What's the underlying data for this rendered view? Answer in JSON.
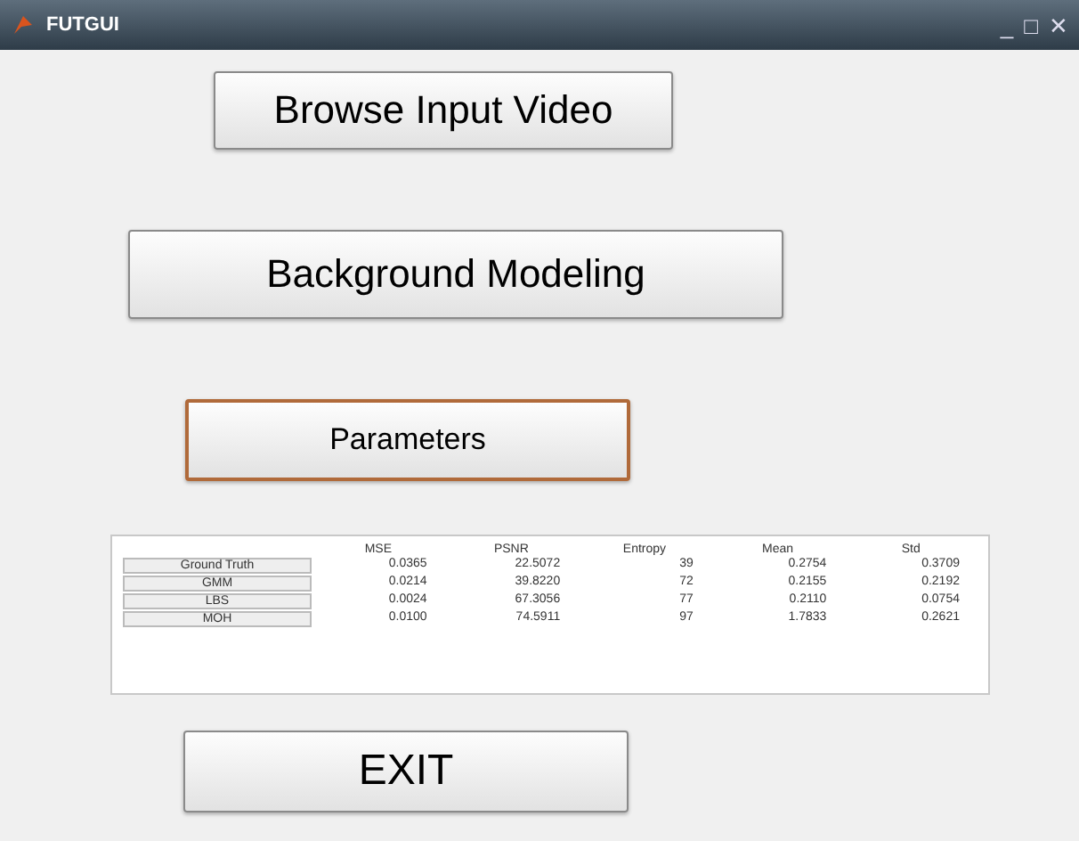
{
  "window": {
    "title": "FUTGUI",
    "controls": [
      "_",
      "□",
      "✕"
    ]
  },
  "buttons": [
    {
      "label": "Browse Input Video",
      "kind": "browse",
      "focused": false
    },
    {
      "label": "Background Modeling",
      "kind": "model",
      "focused": false
    },
    {
      "label": "Parameters",
      "kind": "params",
      "focused": true
    }
  ],
  "table": {
    "columns": [
      "MSE",
      "PSNR",
      "Entropy",
      "Mean",
      "Std"
    ],
    "rows": [
      {
        "label": "Ground Truth",
        "cells": [
          "0.0365",
          "22.5072",
          "39",
          "0.2754",
          "0.3709"
        ]
      },
      {
        "label": "GMM",
        "cells": [
          "0.0214",
          "39.8220",
          "72",
          "0.2155",
          "0.2192"
        ]
      },
      {
        "label": "LBS",
        "cells": [
          "0.0024",
          "67.3056",
          "77",
          "0.2110",
          "0.0754"
        ]
      },
      {
        "label": "MOH",
        "cells": [
          "0.0100",
          "74.5911",
          "97",
          "1.7833",
          "0.2621"
        ]
      }
    ]
  },
  "exit_button": {
    "label": "EXIT"
  }
}
